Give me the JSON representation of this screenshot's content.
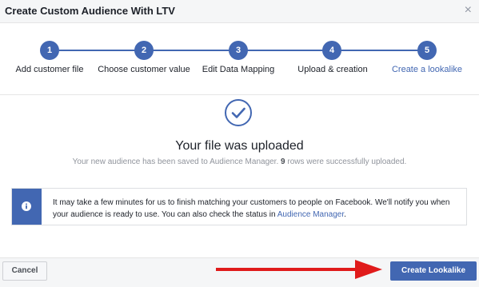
{
  "dialog": {
    "title": "Create Custom Audience With LTV",
    "close_label": "×"
  },
  "steps": [
    {
      "number": "1",
      "label": "Add customer file"
    },
    {
      "number": "2",
      "label": "Choose customer value"
    },
    {
      "number": "3",
      "label": "Edit Data Mapping"
    },
    {
      "number": "4",
      "label": "Upload & creation"
    },
    {
      "number": "5",
      "label": "Create a lookalike"
    }
  ],
  "active_step": 5,
  "success": {
    "title": "Your file was uploaded",
    "subtitle_before": "Your new audience has been saved to Audience Manager.",
    "row_count": "9",
    "subtitle_after": "rows were successfully uploaded."
  },
  "notice": {
    "text": "It may take a few minutes for us to finish matching your customers to people on Facebook. We'll notify you when your audience is ready to use. You can also check the status in",
    "link": "Audience Manager",
    "period": "."
  },
  "footer": {
    "cancel_label": "Cancel",
    "primary_label": "Create Lookalike"
  },
  "colors": {
    "accent": "#4267b2",
    "arrow": "#e01b1b"
  },
  "icons": {
    "close": "close-icon",
    "check": "check-circle-icon",
    "info": "info-icon",
    "arrow": "arrow-right-icon"
  }
}
